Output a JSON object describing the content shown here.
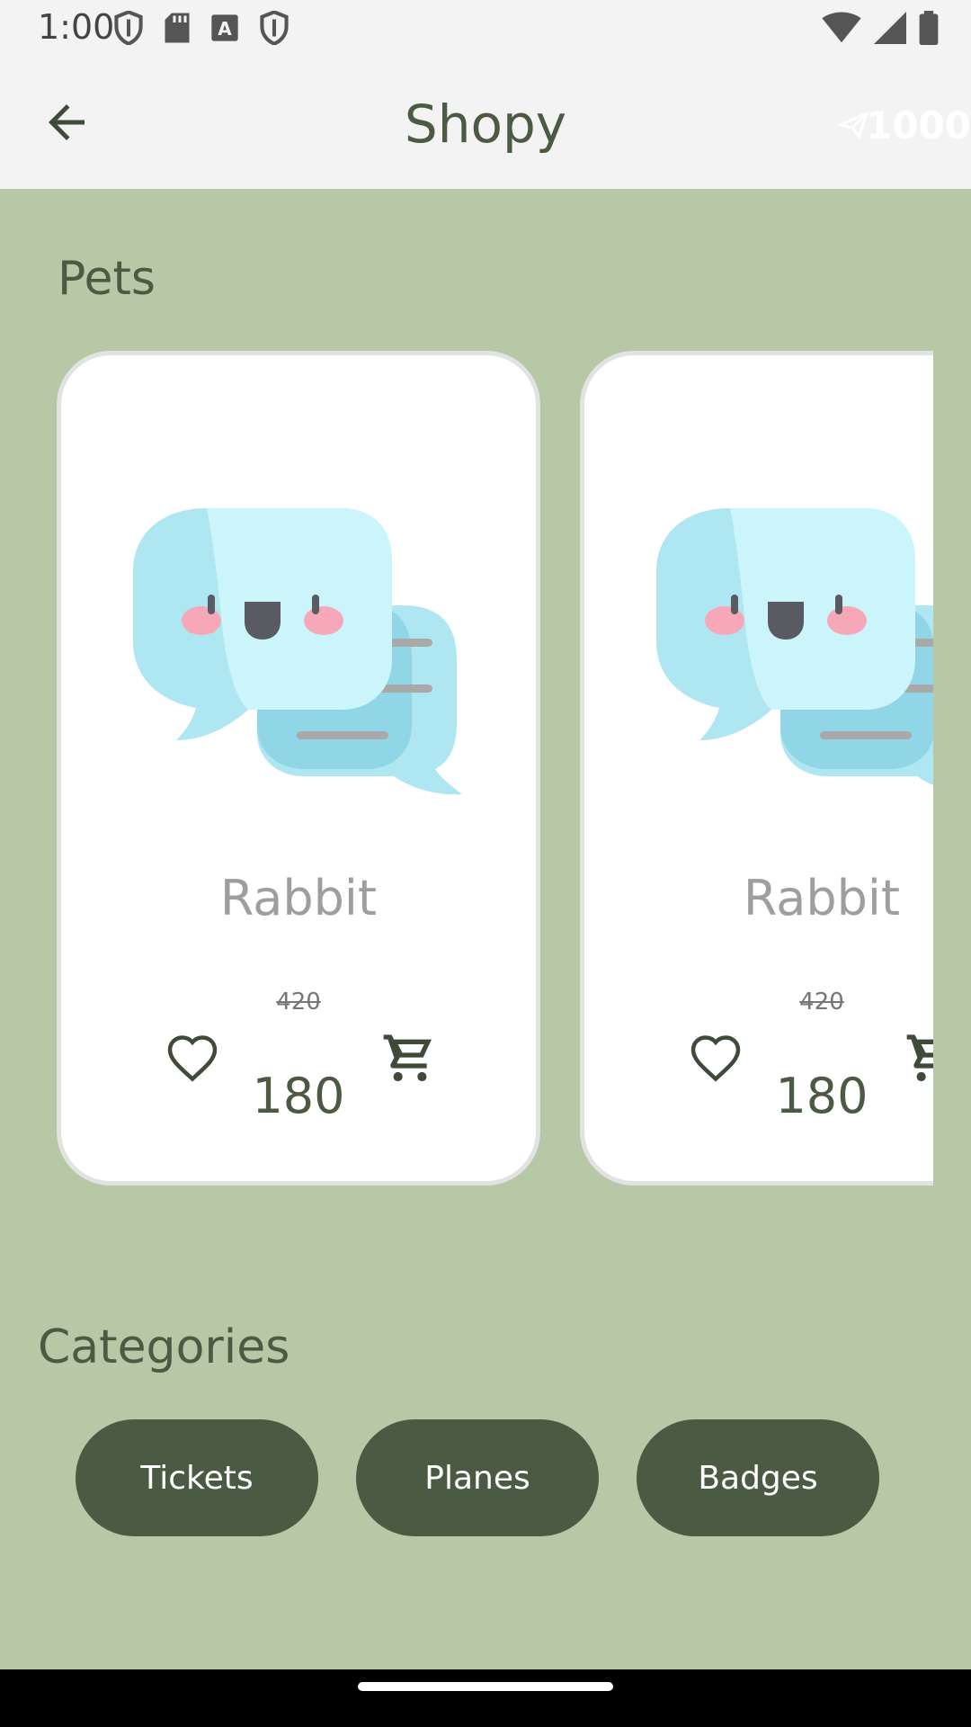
{
  "status_bar": {
    "time": "1:00",
    "left_icons": [
      "shield-icon",
      "sd-card-icon",
      "font-a-icon",
      "shield-icon"
    ],
    "right_icons": [
      "wifi-icon",
      "cell-signal-icon",
      "battery-icon"
    ]
  },
  "app_bar": {
    "title": "Shopy",
    "back_icon": "arrow-back-icon",
    "send_count": "1000"
  },
  "sections": {
    "pets_title": "Pets",
    "categories_title": "Categories"
  },
  "products": [
    {
      "name": "Rabbit",
      "old_price": "420",
      "price": "180"
    },
    {
      "name": "Rabbit",
      "old_price": "420",
      "price": "180"
    }
  ],
  "categories": [
    {
      "label": "Tickets"
    },
    {
      "label": "Planes"
    },
    {
      "label": "Badges"
    }
  ],
  "colors": {
    "background": "#b7c8a6",
    "appbar": "#f3f3f3",
    "accent": "#4b5a43",
    "card": "#ffffff"
  }
}
